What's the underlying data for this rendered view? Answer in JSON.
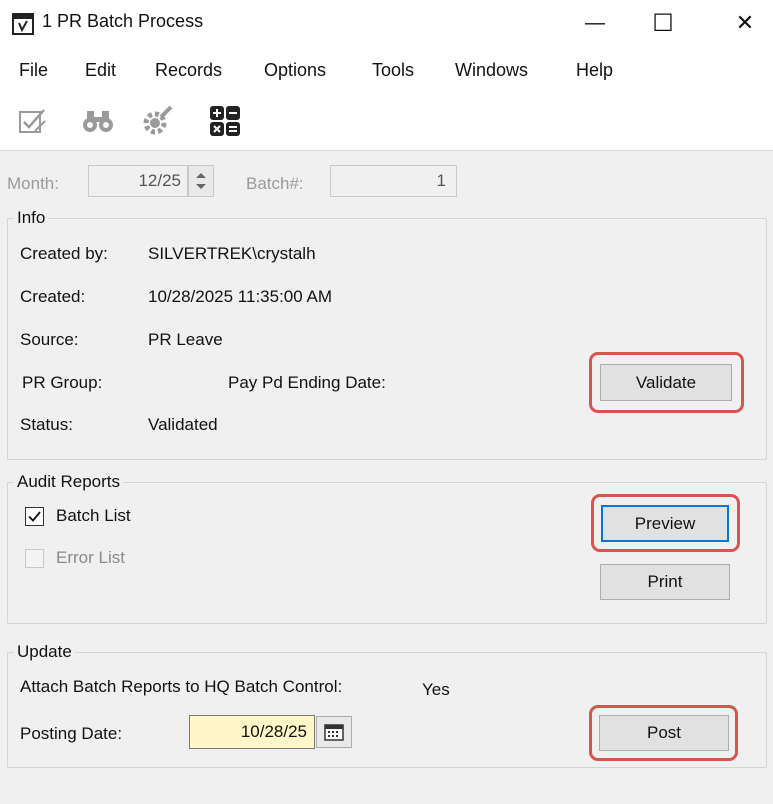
{
  "window": {
    "title": "1 PR Batch Process",
    "minimize_glyph": "—",
    "maximize_glyph": "☐",
    "close_glyph": "✕"
  },
  "menu": [
    "File",
    "Edit",
    "Records",
    "Options",
    "Tools",
    "Windows",
    "Help"
  ],
  "toolbar": {
    "icons": [
      "check-edit-icon",
      "binoculars-icon",
      "gear-wrench-icon",
      "calculator-icon"
    ]
  },
  "header": {
    "month_label": "Month:",
    "month_value": "12/25",
    "batch_label": "Batch#:",
    "batch_value": "1"
  },
  "info": {
    "title": "Info",
    "created_by_label": "Created by:",
    "created_by_value": "SILVERTREK\\crystalh",
    "created_label": "Created:",
    "created_value": "10/28/2025 11:35:00 AM",
    "source_label": "Source:",
    "source_value": "PR Leave",
    "pr_group_label": "PR Group:",
    "pay_pd_label": "Pay Pd Ending Date:",
    "status_label": "Status:",
    "status_value": "Validated",
    "validate_button": "Validate"
  },
  "audit": {
    "title": "Audit Reports",
    "batch_list_label": "Batch List",
    "batch_list_checked": true,
    "error_list_label": "Error List",
    "error_list_checked": false,
    "preview_button": "Preview",
    "print_button": "Print"
  },
  "update": {
    "title": "Update",
    "attach_label": "Attach Batch Reports to HQ Batch Control:",
    "attach_value": "Yes",
    "posting_date_label": "Posting Date:",
    "posting_date_value": "10/28/25",
    "post_button": "Post"
  },
  "colors": {
    "highlight": "#d9534f",
    "focus": "#0078d7",
    "field_yellow": "#fff7c8"
  }
}
